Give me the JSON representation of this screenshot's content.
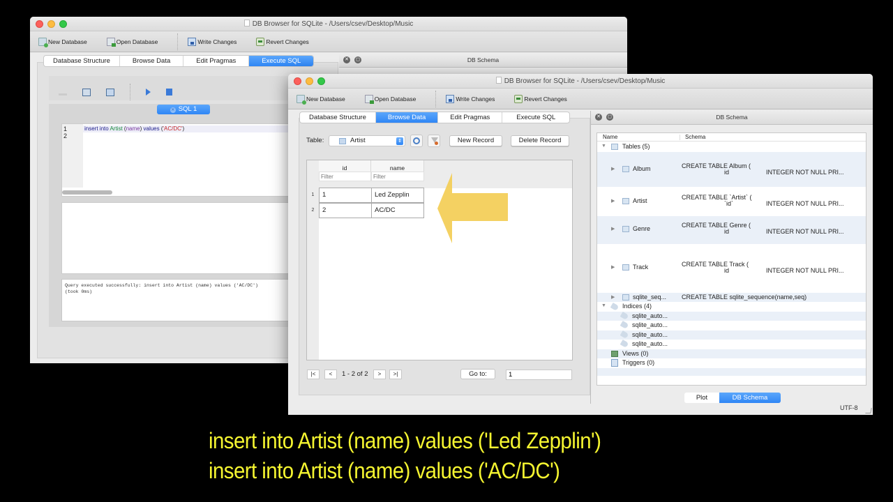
{
  "back_window": {
    "title": "DB Browser for SQLite - /Users/csev/Desktop/Music",
    "toolbar": {
      "new_database": "New Database",
      "open_database": "Open Database",
      "write_changes": "Write Changes",
      "revert_changes": "Revert Changes"
    },
    "tabs": [
      {
        "label": "Database Structure",
        "active": false
      },
      {
        "label": "Browse Data",
        "active": false
      },
      {
        "label": "Edit Pragmas",
        "active": false
      },
      {
        "label": "Execute SQL",
        "active": true
      }
    ],
    "dock_title": "DB Schema",
    "sql_tab": "SQL 1",
    "line_numbers": [
      "1",
      "2"
    ],
    "code": {
      "kw1": "insert into",
      "table": "Artist",
      "col": "name",
      "kw2": "values",
      "str": "'AC/DC'"
    },
    "message_line1": "Query executed successfully: insert into Artist (name) values ('AC/DC')",
    "message_line2": "(took 0ms)"
  },
  "front_window": {
    "title": "DB Browser for SQLite - /Users/csev/Desktop/Music",
    "toolbar": {
      "new_database": "New Database",
      "open_database": "Open Database",
      "write_changes": "Write Changes",
      "revert_changes": "Revert Changes"
    },
    "tabs": [
      {
        "label": "Database Structure",
        "active": false
      },
      {
        "label": "Browse Data",
        "active": true
      },
      {
        "label": "Edit Pragmas",
        "active": false
      },
      {
        "label": "Execute SQL",
        "active": false
      }
    ],
    "browse": {
      "table_label": "Table:",
      "table_value": "Artist",
      "new_record": "New Record",
      "delete_record": "Delete Record",
      "columns": [
        "id",
        "name"
      ],
      "filter_placeholder": "Filter",
      "rows": [
        {
          "rownum": "1",
          "id": "1",
          "name": "Led Zepplin"
        },
        {
          "rownum": "2",
          "id": "2",
          "name": "AC/DC"
        }
      ],
      "nav": {
        "first": "|<",
        "prev": "<",
        "range": "1 - 2 of 2",
        "next": ">",
        "last": ">|",
        "goto_label": "Go to:",
        "goto_value": "1"
      }
    },
    "schema": {
      "dock_title": "DB Schema",
      "col_name": "Name",
      "col_schema": "Schema",
      "tables_label": "Tables (5)",
      "tables": [
        {
          "name": "Album",
          "schema_line1": "CREATE TABLE Album (",
          "schema_line2": "id",
          "schema_type": "INTEGER NOT NULL PRI..."
        },
        {
          "name": "Artist",
          "schema_line1": "CREATE TABLE `Artist` (",
          "schema_line2": "`id`",
          "schema_type": "INTEGER NOT NULL PRI..."
        },
        {
          "name": "Genre",
          "schema_line1": "CREATE TABLE Genre (",
          "schema_line2": "id",
          "schema_type": "INTEGER NOT NULL PRI..."
        },
        {
          "name": "Track",
          "schema_line1": "CREATE TABLE Track (",
          "schema_line2": "id",
          "schema_type": "INTEGER NOT NULL PRI..."
        },
        {
          "name": "sqlite_seq...",
          "schema_line1": "CREATE TABLE sqlite_sequence(name,seq)",
          "schema_line2": "",
          "schema_type": ""
        }
      ],
      "indices_label": "Indices (4)",
      "indices": [
        "sqlite_auto...",
        "sqlite_auto...",
        "sqlite_auto...",
        "sqlite_auto..."
      ],
      "views_label": "Views (0)",
      "triggers_label": "Triggers (0)"
    },
    "bottom_tabs": [
      {
        "label": "Plot",
        "active": false
      },
      {
        "label": "DB Schema",
        "active": true
      }
    ],
    "encoding": "UTF-8"
  },
  "caption": {
    "line1": "insert into Artist (name) values ('Led Zepplin')",
    "line2": "insert into Artist (name) values ('AC/DC')"
  },
  "colors": {
    "accent_blue": "#2f86f5",
    "arrow_yellow": "#f3cf5a",
    "caption_yellow": "#f5f530"
  }
}
